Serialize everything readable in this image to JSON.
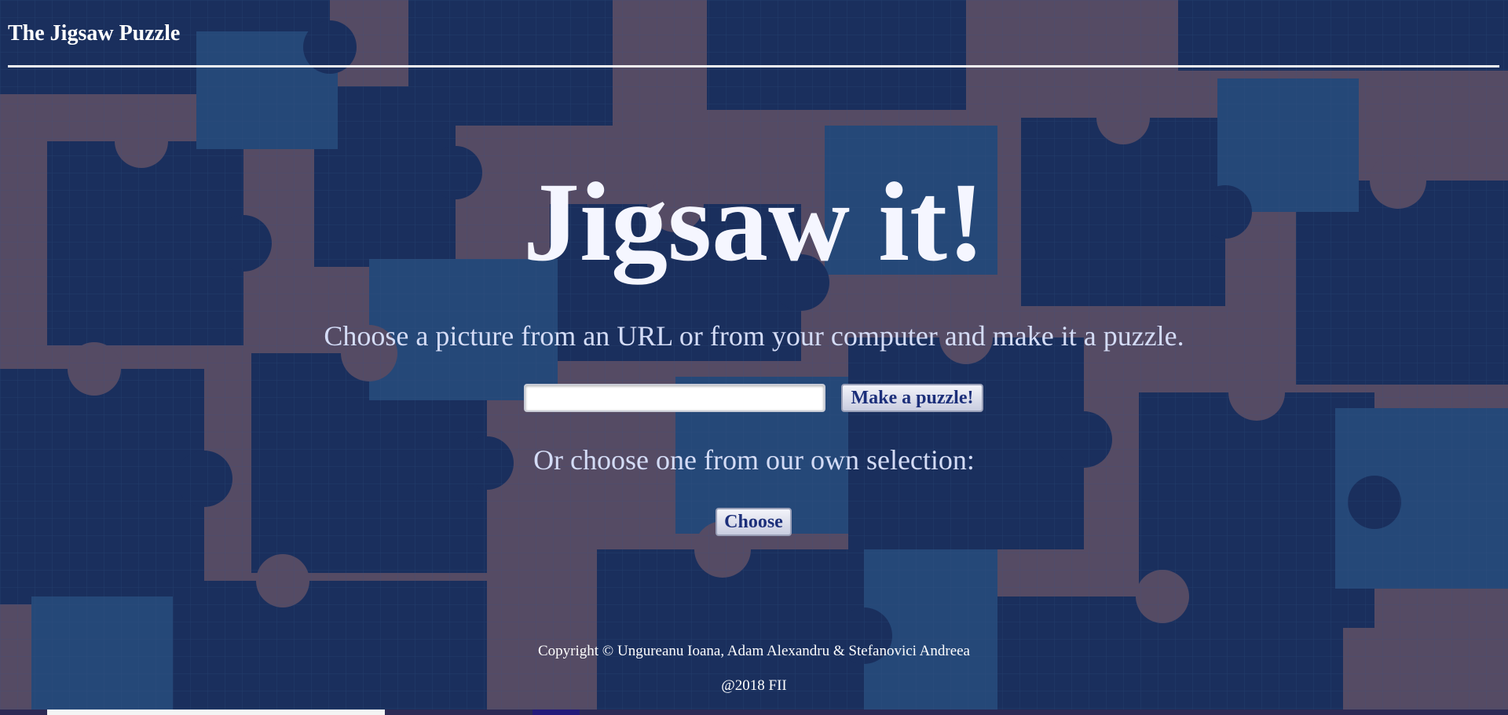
{
  "header": {
    "site_title": "The Jigsaw Puzzle"
  },
  "main": {
    "hero_title": "Jigsaw it!",
    "subtitle": "Choose a picture from an URL or from your computer and make it a puzzle.",
    "url_input": {
      "value": "",
      "placeholder": ""
    },
    "make_button_label": "Make a puzzle!",
    "alternative_text": "Or choose one from our own selection:",
    "choose_button_label": "Choose"
  },
  "footer": {
    "copyright": "Copyright © Ungureanu Ioana, Adam Alexandru & Stefanovici Andreea",
    "year": "@2018 FII"
  },
  "colors": {
    "background_mauve": "#5f5268",
    "background_navy": "#163060",
    "background_blue": "#244f80",
    "title_text": "#f5f6ff",
    "body_text": "#d4dcf6",
    "button_text": "#1c2f7a"
  }
}
